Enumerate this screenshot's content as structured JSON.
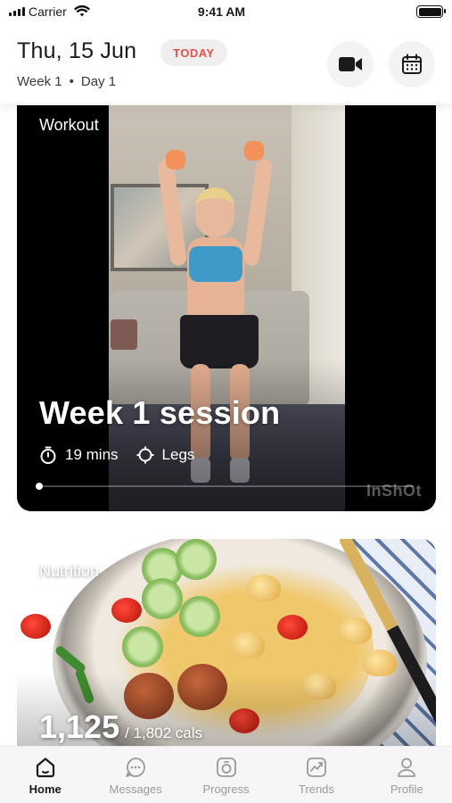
{
  "status_bar": {
    "carrier": "Carrier",
    "time": "9:41 AM"
  },
  "header": {
    "date": "Thu, 15 Jun",
    "today_badge": "TODAY",
    "week": "Week 1",
    "separator": "•",
    "day": "Day 1",
    "icons": [
      "video-camera-icon",
      "calendar-icon"
    ]
  },
  "workout_card": {
    "label": "Workout",
    "title": "Week 1 session",
    "duration": "19 mins",
    "focus": "Legs",
    "video_progress": 0.0,
    "watermark": "InShOt"
  },
  "nutrition_card": {
    "label": "Nutrition",
    "calories_consumed": "1,125",
    "calories_target": "/ 1,802 cals"
  },
  "tab_bar": {
    "active": "Home",
    "tabs": [
      {
        "label": "Home",
        "icon": "home-icon"
      },
      {
        "label": "Messages",
        "icon": "chat-icon"
      },
      {
        "label": "Progress",
        "icon": "progress-icon"
      },
      {
        "label": "Trends",
        "icon": "trends-icon"
      },
      {
        "label": "Profile",
        "icon": "person-icon"
      }
    ]
  },
  "colors": {
    "accent_red": "#e0524e",
    "badge_bg": "#f1eef0",
    "active_tab": "#1a1a1a",
    "inactive_tab": "#9a9a9a"
  }
}
